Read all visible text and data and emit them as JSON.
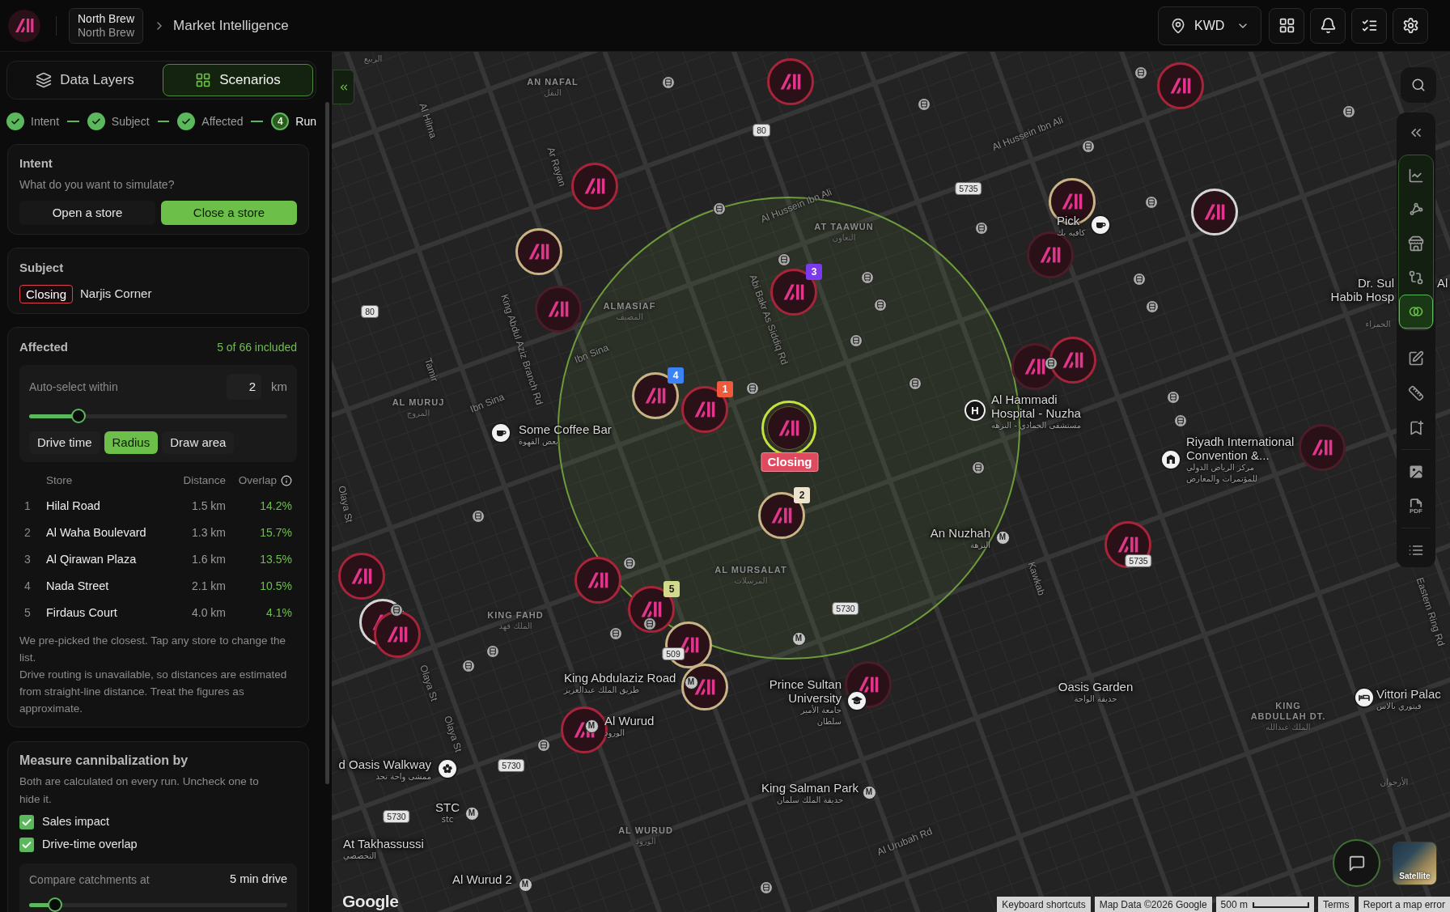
{
  "header": {
    "org": {
      "name": "North Brew",
      "subtitle": "North Brew"
    },
    "breadcrumb": "Market Intelligence",
    "currency": "KWD"
  },
  "sidebar": {
    "tabs": [
      {
        "label": "Data Layers",
        "kind": "layers",
        "selected": false
      },
      {
        "label": "Scenarios",
        "kind": "grid",
        "selected": true
      }
    ],
    "steps": [
      {
        "label": "Intent",
        "done": true
      },
      {
        "label": "Subject",
        "done": true
      },
      {
        "label": "Affected",
        "done": true
      },
      {
        "label": "Run",
        "done": false,
        "number": "4"
      }
    ],
    "intent": {
      "title": "Intent",
      "question": "What do you want to simulate?",
      "options": [
        {
          "label": "Open a store",
          "selected": false
        },
        {
          "label": "Close a store",
          "selected": true
        }
      ]
    },
    "subject": {
      "title": "Subject",
      "badge": "Closing",
      "name": "Narjis Corner"
    },
    "affected": {
      "title": "Affected",
      "count": "5 of 66 included",
      "auto_select": {
        "label": "Auto-select within",
        "value": "2",
        "unit": "km",
        "level": 0.19
      },
      "modes": [
        {
          "label": "Drive time",
          "selected": false
        },
        {
          "label": "Radius",
          "selected": true
        },
        {
          "label": "Draw area",
          "selected": false
        }
      ],
      "columns": [
        "Store",
        "Distance",
        "Overlap"
      ],
      "rows": [
        {
          "index": "1",
          "store": "Hilal Road",
          "distance": "1.5 km",
          "overlap": "14.2%"
        },
        {
          "index": "2",
          "store": "Al Waha Boulevard",
          "distance": "1.3 km",
          "overlap": "15.7%"
        },
        {
          "index": "3",
          "store": "Al Qirawan Plaza",
          "distance": "1.6 km",
          "overlap": "13.5%"
        },
        {
          "index": "4",
          "store": "Nada Street",
          "distance": "2.1 km",
          "overlap": "10.5%"
        },
        {
          "index": "5",
          "store": "Firdaus Court",
          "distance": "4.0 km",
          "overlap": "4.1%"
        }
      ],
      "notes": [
        "We pre-picked the closest. Tap any store to change the list.",
        "Drive routing is unavailable, so distances are estimated from straight-line distance. Treat the figures as approximate."
      ]
    },
    "measure": {
      "title": "Measure cannibalization by",
      "description": "Both are calculated on every run. Uncheck one to hide it.",
      "options": [
        {
          "label": "Sales impact",
          "checked": true
        },
        {
          "label": "Drive-time overlap",
          "checked": true
        }
      ],
      "compare": {
        "label": "Compare catchments at",
        "value": "5 min drive",
        "level": 0.1
      }
    }
  },
  "map": {
    "roads": [
      {
        "name": "Al Hilma"
      },
      {
        "name": "Ar Rayan"
      },
      {
        "name": "Al Hussein Ibn Ali"
      },
      {
        "name": "Al Hussein Ibn Ali"
      },
      {
        "name": "Abi Bakr As Siddiq Rd"
      },
      {
        "name": "King Abdul Aziz Branch Rd"
      },
      {
        "name": "Ibn Sina"
      },
      {
        "name": "Ibn Sina"
      },
      {
        "name": "Tamir"
      },
      {
        "name": "Olaya St"
      },
      {
        "name": "Olaya St"
      },
      {
        "name": "Olaya St"
      },
      {
        "name": "Kawkab"
      },
      {
        "name": "Al Urubah Rd"
      },
      {
        "name": "Eastern Ring Rd"
      }
    ],
    "areas": [
      {
        "lines": [
          "AN NAFAL"
        ],
        "name_ar": "النفل"
      },
      {
        "lines": [
          "AT TAAWUN"
        ],
        "name_ar": "التعاون"
      },
      {
        "lines": [
          "ALMASIAF"
        ],
        "name_ar": "المصيف"
      },
      {
        "lines": [
          "AL MURUJ"
        ],
        "name_ar": "المروج"
      },
      {
        "lines": [
          "AL MURSALAT"
        ],
        "name_ar": "المرسلات"
      },
      {
        "lines": [
          "KING FAHD"
        ],
        "name_ar": "الملك فهد"
      },
      {
        "lines": [
          "AL WURUD"
        ],
        "name_ar": "الورود"
      },
      {
        "lines": [
          "KING",
          "ABDULLAH DT."
        ],
        "name_ar": "الملك عبدالله"
      }
    ],
    "arabic_labels": [
      "الربيع",
      "الحمراء",
      "الأرجوان"
    ],
    "stores": [
      {
        "color": "#a8243a"
      },
      {
        "color": "#a8243a"
      },
      {
        "color": "#a8243a"
      },
      {
        "color": "#c9b486"
      },
      {
        "color": "#4b1d28"
      },
      {
        "color": "#c9b486"
      },
      {
        "color": "#d4d4d4"
      },
      {
        "color": "#4b1d28"
      },
      {
        "color": "#a8243a",
        "badge": {
          "text": "3",
          "color": "#7c3aed"
        }
      },
      {
        "color": "#c9b486",
        "badge": {
          "text": "4",
          "color": "#3b82f6"
        }
      },
      {
        "color": "#a8243a",
        "badge": {
          "text": "1",
          "color": "#f05a3a"
        }
      },
      {
        "color": "#c8e03c",
        "status": "Closing"
      },
      {
        "color": "#c9b486",
        "badge": {
          "text": "2",
          "color": "#ece4cc"
        }
      },
      {
        "color": "#4b1d28"
      },
      {
        "color": "#a8243a"
      },
      {
        "color": "#4b1d28"
      },
      {
        "color": "#a8243a"
      },
      {
        "color": "#a8243a"
      },
      {
        "color": "#d4d4d4"
      },
      {
        "color": "#a8243a"
      },
      {
        "color": "#a8243a"
      },
      {
        "color": "#a8243a",
        "badge": {
          "text": "5",
          "color": "#d3da8c"
        }
      },
      {
        "color": "#c9b486"
      },
      {
        "color": "#c9b486"
      },
      {
        "color": "#4b1d28"
      },
      {
        "color": "#a8243a"
      }
    ],
    "shields": [
      "80",
      "80",
      "5735",
      "5735",
      "5730",
      "5730",
      "5730",
      "509"
    ],
    "metro": [
      {
        "glyph": "M"
      },
      {
        "glyph": "M"
      },
      {
        "glyph": "M"
      },
      {
        "glyph": "M"
      },
      {
        "glyph": "M"
      },
      {
        "glyph": "M"
      },
      {
        "glyph": "M"
      }
    ],
    "places": [
      {
        "lines": [
          "Pick"
        ],
        "lines_ar": [
          "كافيه بك"
        ],
        "kind": "cafe"
      },
      {
        "lines": [
          "Dr. Sul",
          "Habib Hosp"
        ]
      },
      {
        "lines": [
          "Al"
        ]
      },
      {
        "lines": [
          "Al Hammadi",
          "Hospital - Nuzha"
        ],
        "lines_ar": [
          "مستشفى الحمادي - النزهه"
        ],
        "kind": "hospital",
        "glyph": "H"
      },
      {
        "lines": [
          "Some Coffee Bar"
        ],
        "lines_ar": [
          "بعض القهوة"
        ],
        "kind": "cafe"
      },
      {
        "lines": [
          "Riyadh International",
          "Convention &..."
        ],
        "lines_ar": [
          "مركز الرياض الدولي",
          "للمؤتمرات والمعارض"
        ],
        "kind": "venue"
      },
      {
        "lines": [
          "An Nuzhah"
        ],
        "lines_ar": [
          "النزهة"
        ]
      },
      {
        "lines": [
          "King Abdulaziz Road"
        ],
        "lines_ar": [
          "طريق الملك عبدالعزيز"
        ]
      },
      {
        "lines": [
          "Prince Sultan",
          "University"
        ],
        "lines_ar": [
          "جامعة الأمير",
          "سلطان"
        ],
        "kind": "school"
      },
      {
        "lines": [
          "Oasis Garden"
        ],
        "lines_ar": [
          "حديقة الواحة"
        ]
      },
      {
        "lines": [
          "Vittori Palac"
        ],
        "lines_ar": [
          "فيتوري بالاس"
        ],
        "kind": "hotel"
      },
      {
        "lines": [
          "Al Wurud"
        ],
        "lines_ar": [
          "الورود"
        ]
      },
      {
        "lines": [
          "d Oasis Walkway"
        ],
        "lines_ar": [
          "ممشى واحة نجد"
        ],
        "kind": "park"
      },
      {
        "lines": [
          "King Salman Park"
        ],
        "lines_ar": [
          "حديقة الملك سلمان"
        ]
      },
      {
        "lines": [
          "STC"
        ],
        "lines_ar": [
          "stc"
        ]
      },
      {
        "lines": [
          "At Takhassussi"
        ],
        "lines_ar": [
          "التخصصي"
        ]
      },
      {
        "lines": [
          "Al Wurud 2"
        ]
      }
    ],
    "logo": "Google",
    "map_type": "Satellite",
    "attribution": [
      {
        "text": "Keyboard shortcuts"
      },
      {
        "text": "Map Data ©2026 Google"
      },
      {
        "kind": "scale",
        "text": "500 m"
      },
      {
        "text": "Terms"
      },
      {
        "text": "Report a map error"
      }
    ]
  },
  "toolbar": {
    "sections": [
      {
        "highlighted": false,
        "items": [
          {
            "kind": "collapse",
            "selected": false
          }
        ]
      },
      {
        "highlighted": true,
        "items": [
          {
            "kind": "trend",
            "selected": false
          },
          {
            "kind": "network",
            "selected": false
          },
          {
            "kind": "store",
            "selected": false
          },
          {
            "kind": "compare",
            "selected": false
          },
          {
            "kind": "overlap",
            "selected": true
          }
        ]
      },
      {
        "highlighted": false,
        "items": [
          {
            "kind": "edit",
            "selected": false
          },
          {
            "kind": "ruler",
            "selected": false
          },
          {
            "kind": "bookmark",
            "selected": false
          }
        ]
      },
      {
        "highlighted": false,
        "items": [
          {
            "kind": "image",
            "selected": false
          },
          {
            "kind": "pdf",
            "label": "PDF",
            "selected": false
          }
        ]
      },
      {
        "highlighted": false,
        "items": [
          {
            "kind": "list",
            "selected": false
          }
        ]
      }
    ]
  }
}
